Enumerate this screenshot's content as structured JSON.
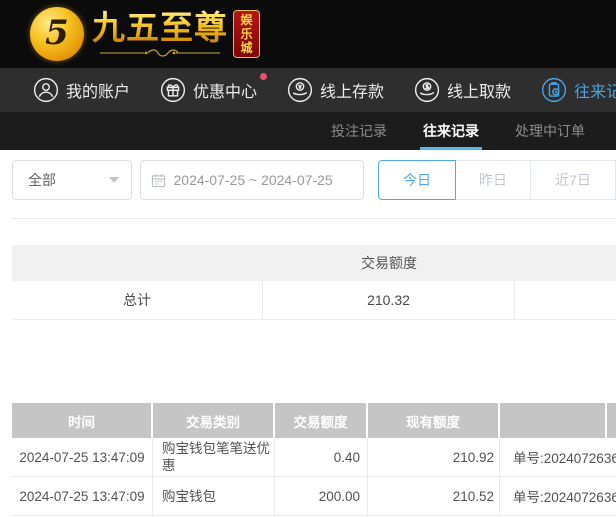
{
  "logo": {
    "symbol": "5",
    "title": "九五至尊",
    "badge_chars": [
      "娱",
      "乐",
      "城"
    ]
  },
  "navbar": {
    "items": [
      {
        "label": "我的账户"
      },
      {
        "label": "优惠中心",
        "has_dot": true
      },
      {
        "label": "线上存款"
      },
      {
        "label": "线上取款"
      },
      {
        "label": "往来记录",
        "active": true
      }
    ]
  },
  "tabs": [
    {
      "label": "投注记录",
      "active": false
    },
    {
      "label": "往来记录",
      "active": true
    },
    {
      "label": "处理中订单",
      "active": false
    }
  ],
  "filters": {
    "type_select": {
      "value": "全部"
    },
    "date_range": "2024-07-25 ~ 2024-07-25",
    "quick_buttons": [
      {
        "label": "今日",
        "active": true
      },
      {
        "label": "昨日",
        "active": false
      },
      {
        "label": "近7日",
        "active": false
      }
    ]
  },
  "summary_table": {
    "amount_header": "交易额度",
    "total_label": "总计",
    "total_amount": "210.32"
  },
  "records_table": {
    "headers": [
      "时间",
      "交易类别",
      "交易额度",
      "现有额度"
    ],
    "rows": [
      {
        "time": "2024-07-25 13:47:09",
        "type": "购宝钱包笔笔送优惠",
        "amount": "0.40",
        "balance": "210.92",
        "note": "单号:2024072636"
      },
      {
        "time": "2024-07-25 13:47:09",
        "type": "购宝钱包",
        "amount": "200.00",
        "balance": "210.52",
        "note": "单号:2024072636"
      }
    ]
  },
  "colors": {
    "accent_blue": "#4aa4e4",
    "tab_underline": "#55b4f2",
    "notification_red": "#ed4d6e",
    "gold": "#f6bd14",
    "badge_red": "#9c0d0d",
    "table_header_gray": "#c5c5c5"
  }
}
